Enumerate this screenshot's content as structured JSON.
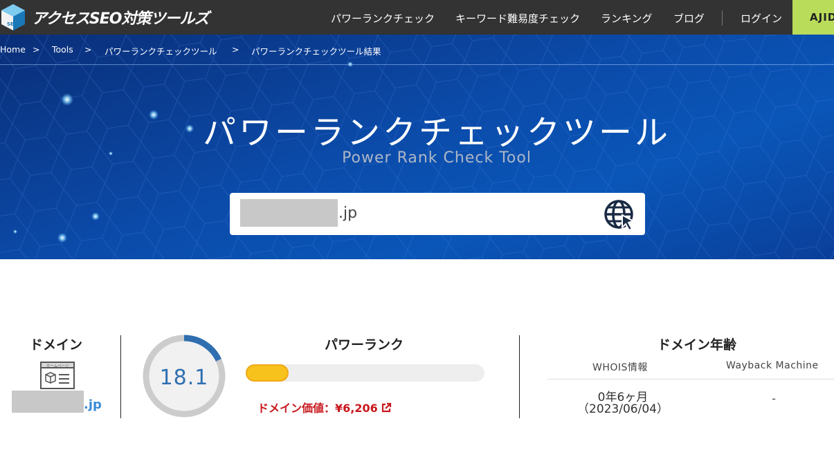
{
  "header": {
    "logo_text": "アクセスSEO対策ツールズ",
    "logo_badge": "SEO",
    "nav": [
      {
        "label": "パワーランクチェック"
      },
      {
        "label": "キーワード難易度チェック"
      },
      {
        "label": "ランキング"
      },
      {
        "label": "ブログ"
      },
      {
        "label": "ログイン"
      }
    ],
    "cta_label": "AJID"
  },
  "breadcrumb": {
    "items": [
      "Home",
      "Tools",
      "パワーランクチェックツール",
      "パワーランクチェックツール結果"
    ],
    "separator": ">"
  },
  "hero": {
    "title": "パワーランクチェックツール",
    "subtitle": "Power Rank Check Tool"
  },
  "search": {
    "value_suffix": ".jp",
    "button_icon": "globe-cursor-icon"
  },
  "result": {
    "domain": {
      "title": "ドメイン",
      "icon": "homepage-icon",
      "icon_caption": "ホームページ",
      "domain_suffix": ".jp"
    },
    "power_rank": {
      "title": "パワーランク",
      "score": "18.1",
      "score_fraction": 0.181,
      "value_label": "ドメイン価値：¥6,206"
    },
    "domain_age": {
      "title": "ドメイン年齢",
      "whois_label": "WHOIS情報",
      "wayback_label": "Wayback Machine",
      "whois_age": "0年6ヶ月",
      "whois_date": "（2023/06/04）",
      "wayback_value": "-"
    }
  },
  "colors": {
    "header_bg": "#333333",
    "hero_blue": "#0b4aa8",
    "cta_green": "#b9dc5a",
    "gauge_blue": "#2f6fb0",
    "bar_yellow": "#f7c21c",
    "value_red": "#c8171c"
  }
}
